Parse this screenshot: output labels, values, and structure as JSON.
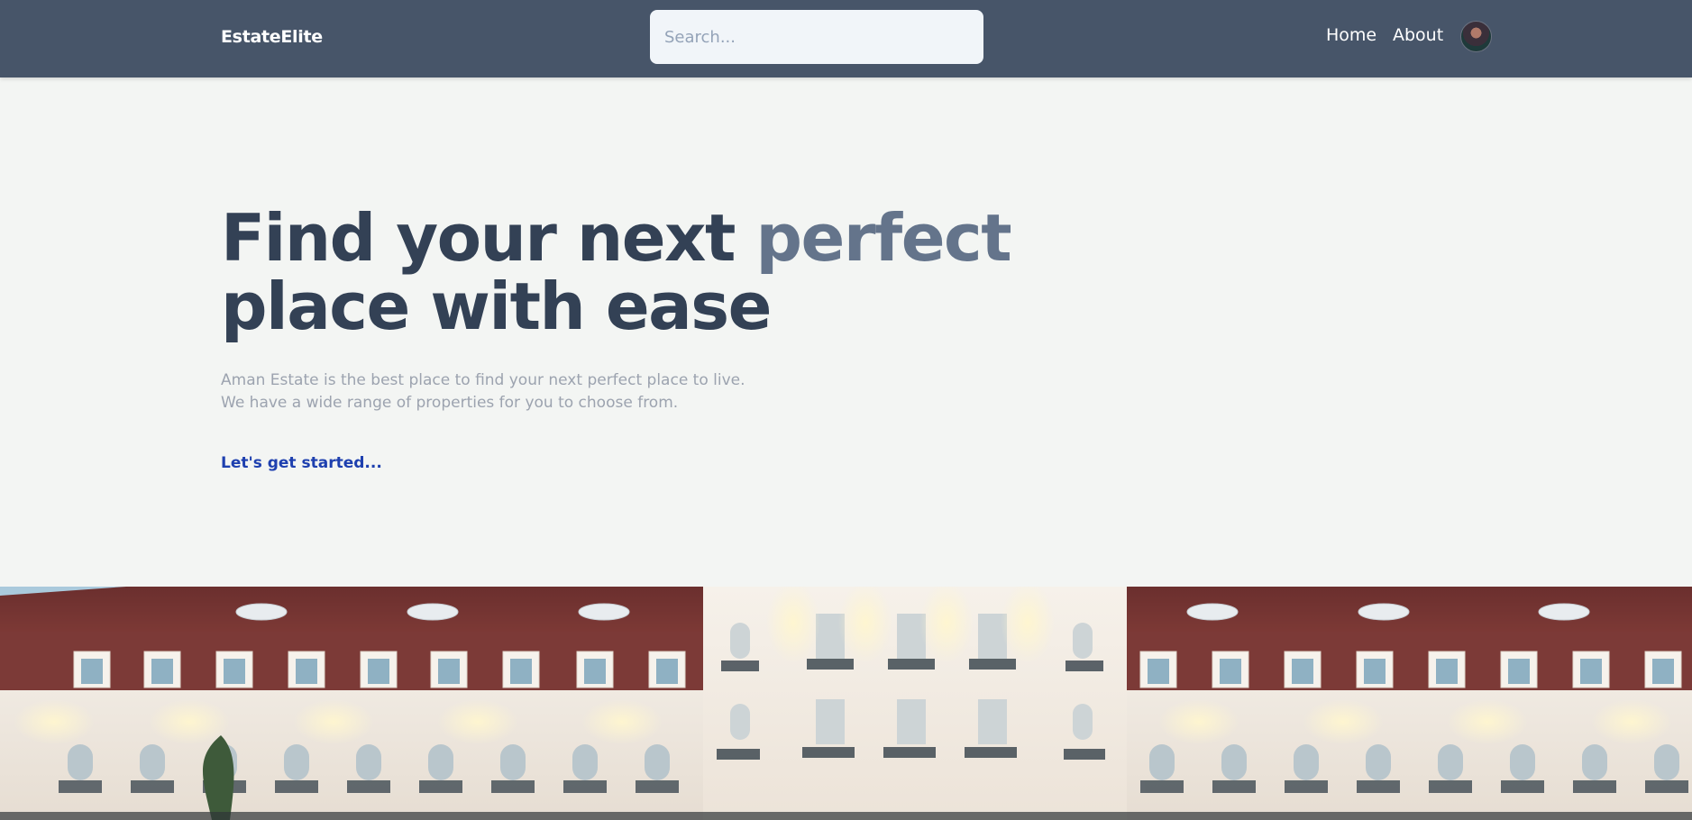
{
  "header": {
    "logo": "EstateElite",
    "search": {
      "placeholder": "Search...",
      "value": ""
    },
    "nav": [
      {
        "label": "Home"
      },
      {
        "label": "About"
      }
    ],
    "avatar_icon": "user-avatar-icon"
  },
  "hero": {
    "title_part1": "Find your next ",
    "title_accent": "perfect",
    "title_part2": "place with ease",
    "subtitle_line1": "Aman Estate is the best place to find your next perfect place to live.",
    "subtitle_line2": "We have a wide range of properties for you to choose from.",
    "cta_label": "Let's get started..."
  },
  "colors": {
    "navbar": "#475569",
    "page_bg": "#f3f5f3",
    "title": "#334155",
    "title_accent": "#64748b",
    "cta": "#1e40af"
  }
}
